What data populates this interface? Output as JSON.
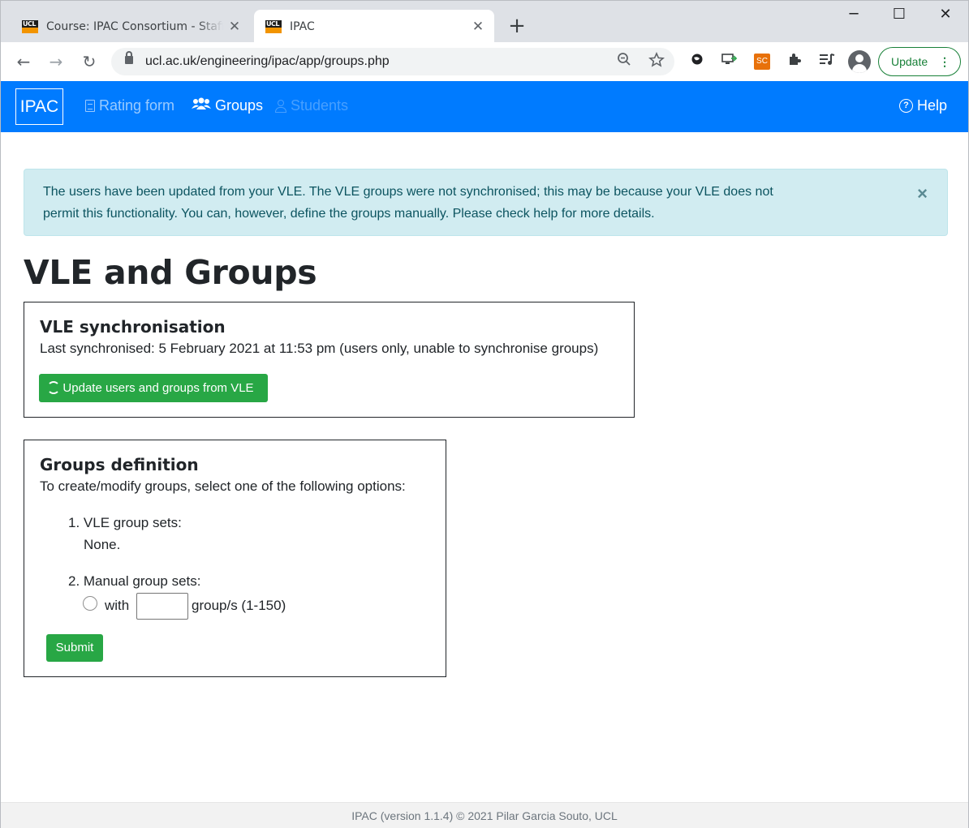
{
  "browser": {
    "tabs": [
      {
        "title": "Course: IPAC Consortium - Staff, T",
        "favicon_text": "UCL"
      },
      {
        "title": "IPAC",
        "favicon_text": "UCL"
      }
    ],
    "tab_close": "✕",
    "new_tab": "+",
    "window": {
      "minimize": "─",
      "maximize": "☐",
      "close": "✕"
    },
    "nav": {
      "back": "←",
      "forward": "→",
      "reload": "↻"
    },
    "url": "ucl.ac.uk/engineering/ipac/app/groups.php",
    "omnibox_icons": {
      "zoom": "zoom-out-icon",
      "bookmark": "star-icon"
    },
    "extensions": {
      "sc_label": "SC"
    },
    "update_label": "Update",
    "update_menu": "⋮"
  },
  "appnav": {
    "brand": "IPAC",
    "links": [
      {
        "label": "Rating form",
        "state": "muted"
      },
      {
        "label": "Groups",
        "state": "active"
      },
      {
        "label": "Students",
        "state": "disabled"
      }
    ],
    "help": {
      "label": "Help",
      "icon": "?"
    }
  },
  "alert": {
    "line1": "The users have been updated from your VLE. The VLE groups were not synchronised; this may be because your VLE does not",
    "line2": "permit this functionality. You can, however, define the groups manually. Please check help for more details.",
    "close": "×"
  },
  "page_title": "VLE and Groups",
  "sync_card": {
    "title": "VLE synchronisation",
    "last_sync": "Last synchronised: 5 February 2021 at 11:53 pm (users only, unable to synchronise groups)",
    "button": "Update users and groups from VLE"
  },
  "groups_card": {
    "title": "Groups definition",
    "intro": "To create/modify groups, select one of the following options:",
    "option1_label": "1. VLE group sets:",
    "option1_value": "None.",
    "option2_label": "2. Manual group sets:",
    "with_label": "with",
    "groups_suffix": "group/s (1-150)",
    "groups_value": "",
    "submit": "Submit"
  },
  "footer": "IPAC (version 1.1.4) © 2021 Pilar Garcia Souto, UCL",
  "colors": {
    "nav": "#007bff",
    "alert_bg": "#d1ecf1",
    "alert_text": "#0c5460",
    "button": "#28a745"
  }
}
